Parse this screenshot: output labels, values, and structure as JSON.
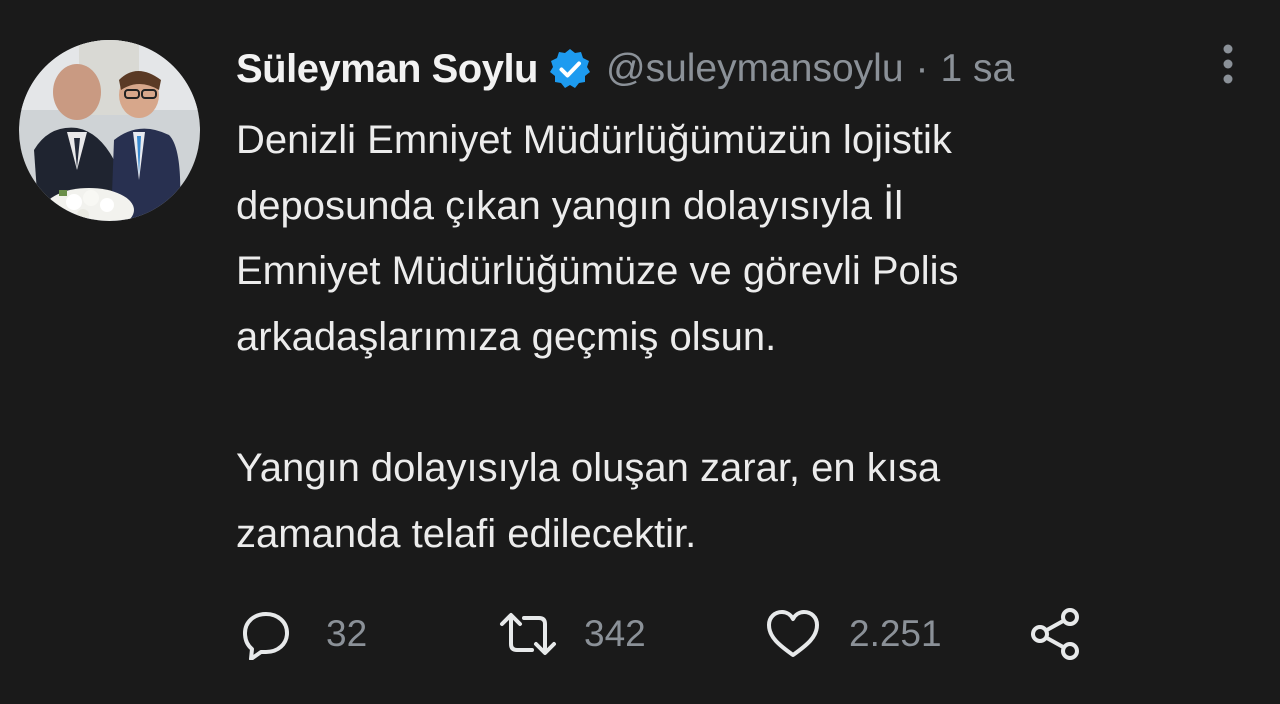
{
  "tweet": {
    "author": {
      "display_name": "Süleyman Soylu",
      "handle": "@suleymansoylu",
      "verified": true
    },
    "separator": "·",
    "time": "1 sa",
    "text": "Denizli Emniyet Müdürlüğümüzün lojistik\ndeposunda çıkan yangın  dolayısıyla İl\nEmniyet Müdürlüğümüze ve görevli Polis\narkadaşlarımıza geçmiş olsun.\n\nYangın dolayısıyla oluşan zarar, en kısa\nzamanda telafi edilecektir.",
    "actions": {
      "reply_count": "32",
      "retweet_count": "342",
      "like_count": "2.251"
    }
  },
  "icons": {
    "more": "more-vertical-icon",
    "reply": "reply-icon",
    "retweet": "retweet-icon",
    "like": "heart-icon",
    "share": "share-icon",
    "verified": "verified-badge-icon"
  },
  "colors": {
    "background": "#1a1a1a",
    "text": "#e7e9ea",
    "secondary_text": "#8b9198",
    "verified_blue": "#1d9bf0"
  }
}
